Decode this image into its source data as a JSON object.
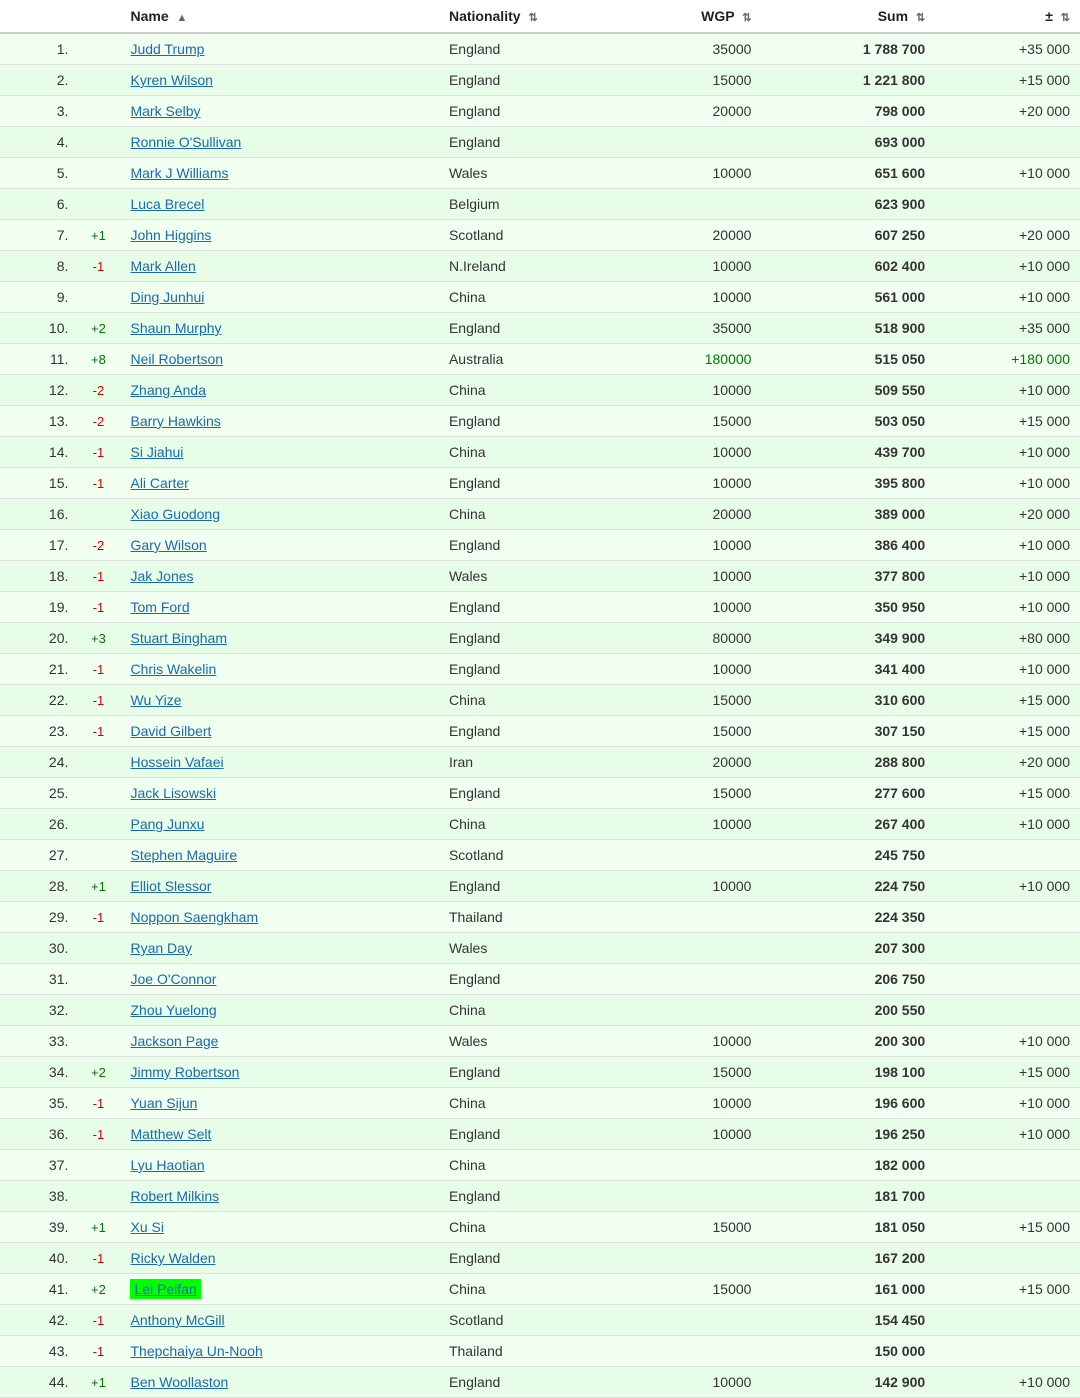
{
  "table": {
    "columns": [
      {
        "label": "Name",
        "sortable": true,
        "sort_icon": "▲"
      },
      {
        "label": "Nationality",
        "sortable": true,
        "sort_icon": "⇅"
      },
      {
        "label": "WGP",
        "sortable": true,
        "sort_icon": "⇅"
      },
      {
        "label": "Sum",
        "sortable": true,
        "sort_icon": "⇅"
      },
      {
        "label": "±",
        "sortable": true,
        "sort_icon": "⇅"
      }
    ],
    "rows": [
      {
        "rank": "1.",
        "change": "",
        "name": "Judd Trump",
        "nationality": "England",
        "wgp": "35000",
        "sum": "1 788 700",
        "pm": "+35 000",
        "highlight_name": false
      },
      {
        "rank": "2.",
        "change": "",
        "name": "Kyren Wilson",
        "nationality": "England",
        "wgp": "15000",
        "sum": "1 221 800",
        "pm": "+15 000",
        "highlight_name": false
      },
      {
        "rank": "3.",
        "change": "",
        "name": "Mark Selby",
        "nationality": "England",
        "wgp": "20000",
        "sum": "798 000",
        "pm": "+20 000",
        "highlight_name": false
      },
      {
        "rank": "4.",
        "change": "",
        "name": "Ronnie O'Sullivan",
        "nationality": "England",
        "wgp": "",
        "sum": "693 000",
        "pm": "",
        "highlight_name": false
      },
      {
        "rank": "5.",
        "change": "",
        "name": "Mark J Williams",
        "nationality": "Wales",
        "wgp": "10000",
        "sum": "651 600",
        "pm": "+10 000",
        "highlight_name": false
      },
      {
        "rank": "6.",
        "change": "",
        "name": "Luca Brecel",
        "nationality": "Belgium",
        "wgp": "",
        "sum": "623 900",
        "pm": "",
        "highlight_name": false
      },
      {
        "rank": "7.",
        "change": "+1",
        "name": "John Higgins",
        "nationality": "Scotland",
        "wgp": "20000",
        "sum": "607 250",
        "pm": "+20 000",
        "highlight_name": false
      },
      {
        "rank": "8.",
        "change": "-1",
        "name": "Mark Allen",
        "nationality": "N.Ireland",
        "wgp": "10000",
        "sum": "602 400",
        "pm": "+10 000",
        "highlight_name": false
      },
      {
        "rank": "9.",
        "change": "",
        "name": "Ding Junhui",
        "nationality": "China",
        "wgp": "10000",
        "sum": "561 000",
        "pm": "+10 000",
        "highlight_name": false
      },
      {
        "rank": "10.",
        "change": "+2",
        "name": "Shaun Murphy",
        "nationality": "England",
        "wgp": "35000",
        "sum": "518 900",
        "pm": "+35 000",
        "highlight_name": false
      },
      {
        "rank": "11.",
        "change": "+8",
        "name": "Neil Robertson",
        "nationality": "Australia",
        "wgp": "180000",
        "sum": "515 050",
        "pm": "+180 000",
        "highlight_name": false,
        "highlight_wgp": true,
        "highlight_pm": true
      },
      {
        "rank": "12.",
        "change": "-2",
        "name": "Zhang Anda",
        "nationality": "China",
        "wgp": "10000",
        "sum": "509 550",
        "pm": "+10 000",
        "highlight_name": false
      },
      {
        "rank": "13.",
        "change": "-2",
        "name": "Barry Hawkins",
        "nationality": "England",
        "wgp": "15000",
        "sum": "503 050",
        "pm": "+15 000",
        "highlight_name": false
      },
      {
        "rank": "14.",
        "change": "-1",
        "name": "Si Jiahui",
        "nationality": "China",
        "wgp": "10000",
        "sum": "439 700",
        "pm": "+10 000",
        "highlight_name": false
      },
      {
        "rank": "15.",
        "change": "-1",
        "name": "Ali Carter",
        "nationality": "England",
        "wgp": "10000",
        "sum": "395 800",
        "pm": "+10 000",
        "highlight_name": false
      },
      {
        "rank": "16.",
        "change": "",
        "name": "Xiao Guodong",
        "nationality": "China",
        "wgp": "20000",
        "sum": "389 000",
        "pm": "+20 000",
        "highlight_name": false
      },
      {
        "rank": "17.",
        "change": "-2",
        "name": "Gary Wilson",
        "nationality": "England",
        "wgp": "10000",
        "sum": "386 400",
        "pm": "+10 000",
        "highlight_name": false
      },
      {
        "rank": "18.",
        "change": "-1",
        "name": "Jak Jones",
        "nationality": "Wales",
        "wgp": "10000",
        "sum": "377 800",
        "pm": "+10 000",
        "highlight_name": false
      },
      {
        "rank": "19.",
        "change": "-1",
        "name": "Tom Ford",
        "nationality": "England",
        "wgp": "10000",
        "sum": "350 950",
        "pm": "+10 000",
        "highlight_name": false
      },
      {
        "rank": "20.",
        "change": "+3",
        "name": "Stuart Bingham",
        "nationality": "England",
        "wgp": "80000",
        "sum": "349 900",
        "pm": "+80 000",
        "highlight_name": false
      },
      {
        "rank": "21.",
        "change": "-1",
        "name": "Chris Wakelin",
        "nationality": "England",
        "wgp": "10000",
        "sum": "341 400",
        "pm": "+10 000",
        "highlight_name": false
      },
      {
        "rank": "22.",
        "change": "-1",
        "name": "Wu Yize",
        "nationality": "China",
        "wgp": "15000",
        "sum": "310 600",
        "pm": "+15 000",
        "highlight_name": false
      },
      {
        "rank": "23.",
        "change": "-1",
        "name": "David Gilbert",
        "nationality": "England",
        "wgp": "15000",
        "sum": "307 150",
        "pm": "+15 000",
        "highlight_name": false
      },
      {
        "rank": "24.",
        "change": "",
        "name": "Hossein Vafaei",
        "nationality": "Iran",
        "wgp": "20000",
        "sum": "288 800",
        "pm": "+20 000",
        "highlight_name": false
      },
      {
        "rank": "25.",
        "change": "",
        "name": "Jack Lisowski",
        "nationality": "England",
        "wgp": "15000",
        "sum": "277 600",
        "pm": "+15 000",
        "highlight_name": false
      },
      {
        "rank": "26.",
        "change": "",
        "name": "Pang Junxu",
        "nationality": "China",
        "wgp": "10000",
        "sum": "267 400",
        "pm": "+10 000",
        "highlight_name": false
      },
      {
        "rank": "27.",
        "change": "",
        "name": "Stephen Maguire",
        "nationality": "Scotland",
        "wgp": "",
        "sum": "245 750",
        "pm": "",
        "highlight_name": false
      },
      {
        "rank": "28.",
        "change": "+1",
        "name": "Elliot Slessor",
        "nationality": "England",
        "wgp": "10000",
        "sum": "224 750",
        "pm": "+10 000",
        "highlight_name": false
      },
      {
        "rank": "29.",
        "change": "-1",
        "name": "Noppon Saengkham",
        "nationality": "Thailand",
        "wgp": "",
        "sum": "224 350",
        "pm": "",
        "highlight_name": false
      },
      {
        "rank": "30.",
        "change": "",
        "name": "Ryan Day",
        "nationality": "Wales",
        "wgp": "",
        "sum": "207 300",
        "pm": "",
        "highlight_name": false
      },
      {
        "rank": "31.",
        "change": "",
        "name": "Joe O'Connor",
        "nationality": "England",
        "wgp": "",
        "sum": "206 750",
        "pm": "",
        "highlight_name": false
      },
      {
        "rank": "32.",
        "change": "",
        "name": "Zhou Yuelong",
        "nationality": "China",
        "wgp": "",
        "sum": "200 550",
        "pm": "",
        "highlight_name": false
      },
      {
        "rank": "33.",
        "change": "",
        "name": "Jackson Page",
        "nationality": "Wales",
        "wgp": "10000",
        "sum": "200 300",
        "pm": "+10 000",
        "highlight_name": false
      },
      {
        "rank": "34.",
        "change": "+2",
        "name": "Jimmy Robertson",
        "nationality": "England",
        "wgp": "15000",
        "sum": "198 100",
        "pm": "+15 000",
        "highlight_name": false
      },
      {
        "rank": "35.",
        "change": "-1",
        "name": "Yuan Sijun",
        "nationality": "China",
        "wgp": "10000",
        "sum": "196 600",
        "pm": "+10 000",
        "highlight_name": false
      },
      {
        "rank": "36.",
        "change": "-1",
        "name": "Matthew Selt",
        "nationality": "England",
        "wgp": "10000",
        "sum": "196 250",
        "pm": "+10 000",
        "highlight_name": false
      },
      {
        "rank": "37.",
        "change": "",
        "name": "Lyu Haotian",
        "nationality": "China",
        "wgp": "",
        "sum": "182 000",
        "pm": "",
        "highlight_name": false
      },
      {
        "rank": "38.",
        "change": "",
        "name": "Robert Milkins",
        "nationality": "England",
        "wgp": "",
        "sum": "181 700",
        "pm": "",
        "highlight_name": false
      },
      {
        "rank": "39.",
        "change": "+1",
        "name": "Xu Si",
        "nationality": "China",
        "wgp": "15000",
        "sum": "181 050",
        "pm": "+15 000",
        "highlight_name": false
      },
      {
        "rank": "40.",
        "change": "-1",
        "name": "Ricky Walden",
        "nationality": "England",
        "wgp": "",
        "sum": "167 200",
        "pm": "",
        "highlight_name": false
      },
      {
        "rank": "41.",
        "change": "+2",
        "name": "Lei Peifan",
        "nationality": "China",
        "wgp": "15000",
        "sum": "161 000",
        "pm": "+15 000",
        "highlight_name": true
      },
      {
        "rank": "42.",
        "change": "-1",
        "name": "Anthony McGill",
        "nationality": "Scotland",
        "wgp": "",
        "sum": "154 450",
        "pm": "",
        "highlight_name": false
      },
      {
        "rank": "43.",
        "change": "-1",
        "name": "Thepchaiya Un-Nooh",
        "nationality": "Thailand",
        "wgp": "",
        "sum": "150 000",
        "pm": "",
        "highlight_name": false
      },
      {
        "rank": "44.",
        "change": "+1",
        "name": "Ben Woollaston",
        "nationality": "England",
        "wgp": "10000",
        "sum": "142 900",
        "pm": "+10 000",
        "highlight_name": false
      }
    ]
  }
}
